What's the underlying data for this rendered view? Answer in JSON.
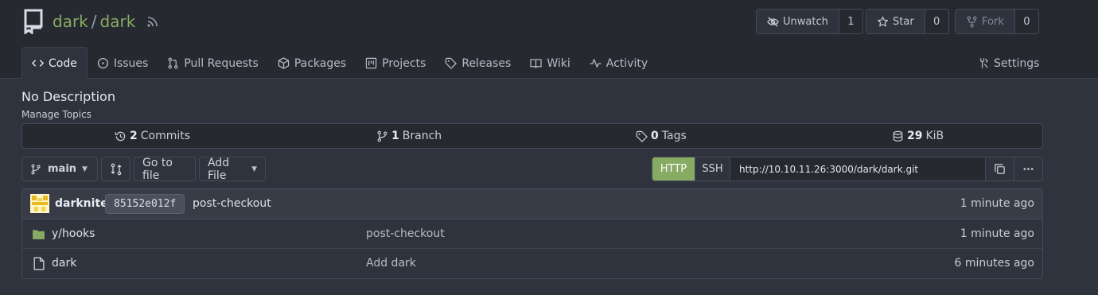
{
  "repo": {
    "owner": "dark",
    "separator": "/",
    "name": "dark"
  },
  "actions": {
    "unwatch": {
      "label": "Unwatch",
      "count": "1"
    },
    "star": {
      "label": "Star",
      "count": "0"
    },
    "fork": {
      "label": "Fork",
      "count": "0"
    }
  },
  "tabs": [
    {
      "label": "Code",
      "icon": "code-icon",
      "active": true
    },
    {
      "label": "Issues",
      "icon": "issue-icon"
    },
    {
      "label": "Pull Requests",
      "icon": "pull-request-icon"
    },
    {
      "label": "Packages",
      "icon": "package-icon"
    },
    {
      "label": "Projects",
      "icon": "project-icon"
    },
    {
      "label": "Releases",
      "icon": "tag-icon"
    },
    {
      "label": "Wiki",
      "icon": "book-icon"
    },
    {
      "label": "Activity",
      "icon": "pulse-icon"
    }
  ],
  "settings_tab": "Settings",
  "description": "No Description",
  "manage_topics": "Manage Topics",
  "stats": {
    "commits": {
      "count": "2",
      "label": "Commits"
    },
    "branches": {
      "count": "1",
      "label": "Branch"
    },
    "tags": {
      "count": "0",
      "label": "Tags"
    },
    "size": {
      "count": "29",
      "label": "KiB"
    }
  },
  "toolbar": {
    "branch": "main",
    "go_to_file": "Go to file",
    "add_file": "Add File",
    "caret": "▼"
  },
  "clone": {
    "http": "HTTP",
    "ssh": "SSH",
    "url": "http://10.10.11.26:3000/dark/dark.git"
  },
  "latest_commit": {
    "author": "darknite",
    "sha": "85152e012f",
    "message": "post-checkout",
    "time": "1 minute ago"
  },
  "files": [
    {
      "type": "folder",
      "name": "y/hooks",
      "message": "post-checkout",
      "time": "1 minute ago"
    },
    {
      "type": "file",
      "name": "dark",
      "message": "Add dark",
      "time": "6 minutes ago"
    }
  ],
  "colors": {
    "accent": "#87ab63",
    "background": "#2f333d",
    "header": "#262930"
  }
}
